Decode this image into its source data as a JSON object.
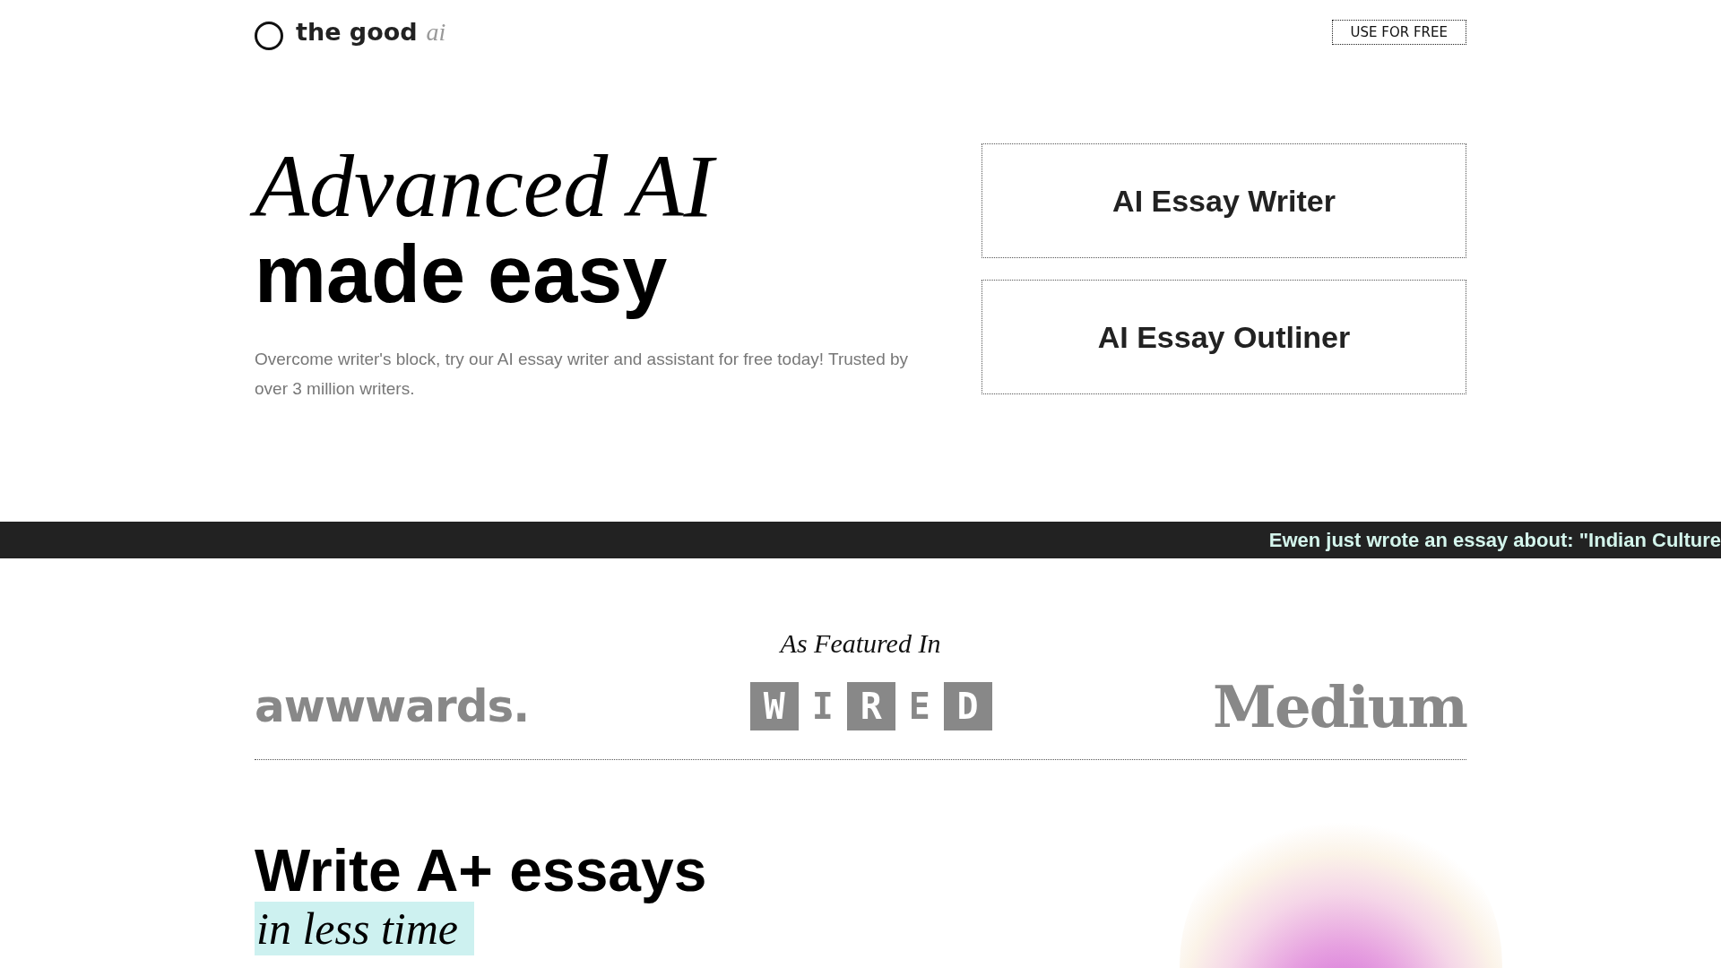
{
  "header": {
    "logo_text": "the good",
    "logo_accent": "ai",
    "cta": "USE FOR FREE"
  },
  "hero": {
    "title_italic": "Advanced AI",
    "title_bold": "made easy",
    "description": "Overcome writer's block, try our AI essay writer and assistant for free today! Trusted by over 3 million writers.",
    "tools": [
      "AI Essay Writer",
      "AI Essay Outliner"
    ]
  },
  "ticker": {
    "text": "Ewen just wrote an essay about: \"Indian Culture"
  },
  "featured": {
    "heading": "As Featured In",
    "logos": [
      {
        "kind": "awwwards",
        "text": "awwwards."
      },
      {
        "kind": "wired",
        "text": "WIRED"
      },
      {
        "kind": "medium",
        "text": "Medium"
      }
    ]
  },
  "section": {
    "title": "Write A+ essays",
    "highlight": "in less time"
  }
}
